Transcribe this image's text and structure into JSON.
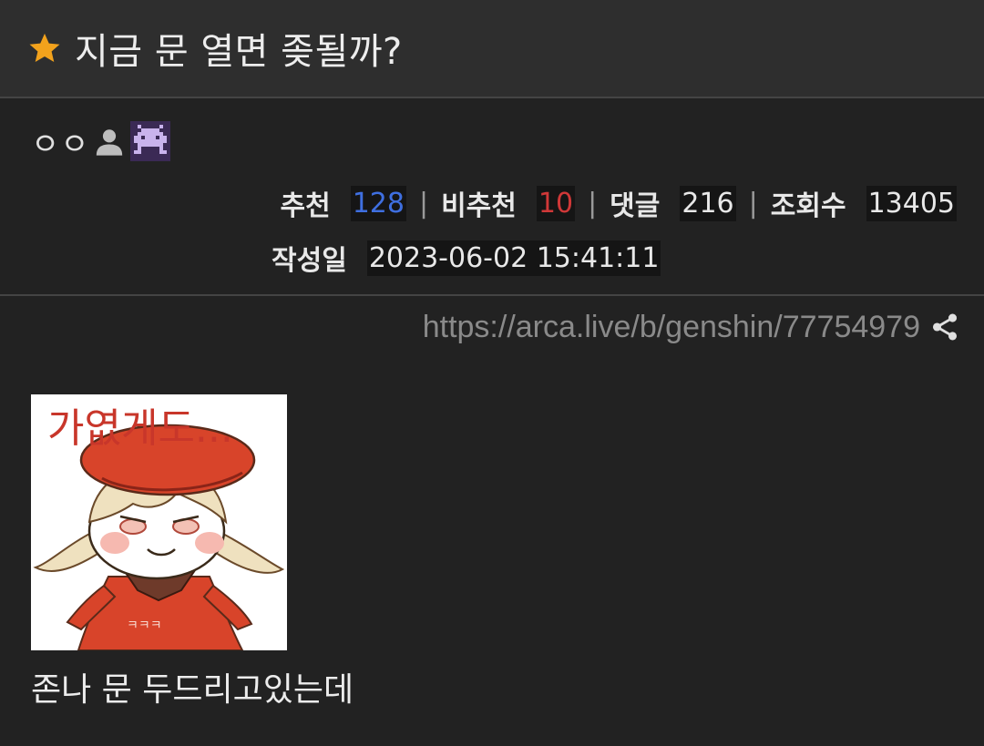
{
  "post": {
    "title": "지금 문 열면 좆될까?",
    "author": "ㅇㅇ",
    "url": "https://arca.live/b/genshin/77754979",
    "body": "존나 문 두드리고있는데",
    "sticker_text": "가엾게도...",
    "sticker_subtext": "ㅋㅋㅋ"
  },
  "stats": {
    "recommend_label": "추천",
    "recommend_value": "128",
    "not_recommend_label": "비추천",
    "not_recommend_value": "10",
    "comments_label": "댓글",
    "comments_value": "216",
    "views_label": "조회수",
    "views_value": "13405",
    "date_label": "작성일",
    "date_value": "2023-06-02 15:41:11",
    "separator": "|"
  },
  "colors": {
    "background": "#222222",
    "title_bar": "#2e2e2e",
    "star": "#f2a21c",
    "recommend": "#3f6fe0",
    "not_recommend": "#d03838",
    "url": "#8a8a8a"
  },
  "icons": {
    "title": "star-icon",
    "author": "person-icon",
    "badge": "pixel-invader-badge-icon",
    "share": "share-icon"
  }
}
